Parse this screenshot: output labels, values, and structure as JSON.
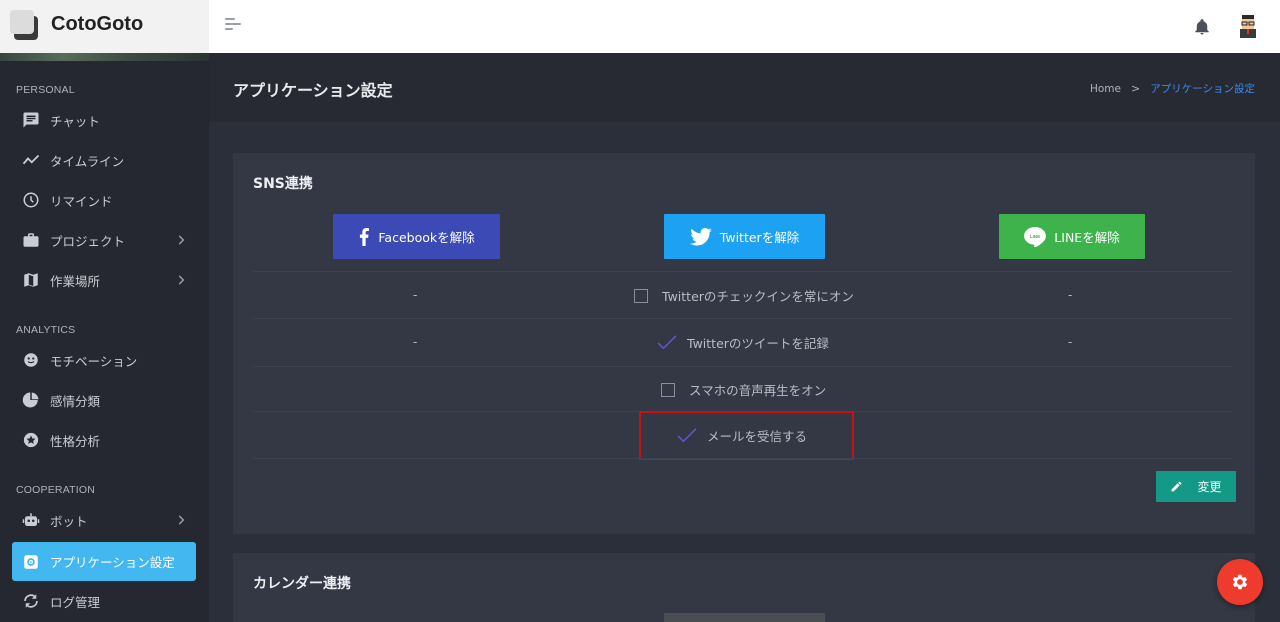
{
  "brand": {
    "name": "CotoGoto"
  },
  "header": {
    "icons": [
      "menu-toggle-icon",
      "bell-icon",
      "avatar"
    ]
  },
  "sidebar": {
    "sections": [
      {
        "label": "PERSONAL"
      },
      {
        "label": "ANALYTICS"
      },
      {
        "label": "COOPERATION"
      }
    ],
    "items": [
      {
        "label": "チャット",
        "icon": "chat-icon",
        "submenu": false
      },
      {
        "label": "タイムライン",
        "icon": "timeline-icon",
        "submenu": false
      },
      {
        "label": "リマインド",
        "icon": "clock-icon",
        "submenu": false
      },
      {
        "label": "プロジェクト",
        "icon": "briefcase-icon",
        "submenu": true
      },
      {
        "label": "作業場所",
        "icon": "map-icon",
        "submenu": true
      },
      {
        "label": "モチベーション",
        "icon": "face-icon",
        "submenu": false
      },
      {
        "label": "感情分類",
        "icon": "pie-icon",
        "submenu": false
      },
      {
        "label": "性格分析",
        "icon": "star-icon",
        "submenu": false
      },
      {
        "label": "ボット",
        "icon": "robot-icon",
        "submenu": true
      },
      {
        "label": "アプリケーション設定",
        "icon": "settings-icon",
        "submenu": false,
        "active": true
      },
      {
        "label": "ログ管理",
        "icon": "sync-icon",
        "submenu": false
      }
    ]
  },
  "page": {
    "title": "アプリケーション設定",
    "breadcrumb": {
      "home": "Home",
      "separator": ">",
      "current": "アプリケーション設定"
    }
  },
  "sns": {
    "title": "SNS連携",
    "buttons": {
      "facebook": "Facebookを解除",
      "twitter": "Twitterを解除",
      "line": "LINEを解除"
    },
    "placeholder": "-",
    "options": [
      {
        "label": "Twitterのチェックインを常にオン",
        "checked": false
      },
      {
        "label": "Twitterのツイートを記録",
        "checked": true
      },
      {
        "label": "スマホの音声再生をオン",
        "checked": false
      },
      {
        "label": "メールを受信する",
        "checked": true
      }
    ],
    "change_label": "変更"
  },
  "calendar": {
    "title": "カレンダー連携"
  },
  "colors": {
    "accent_active": "#43b7f0",
    "facebook": "#3b4ab5",
    "twitter": "#1da1f2",
    "line": "#3eb34b",
    "change": "#139985",
    "fab": "#ef3b2d",
    "highlight": "#c8101a",
    "breadcrumb_current": "#3d8bf0"
  }
}
